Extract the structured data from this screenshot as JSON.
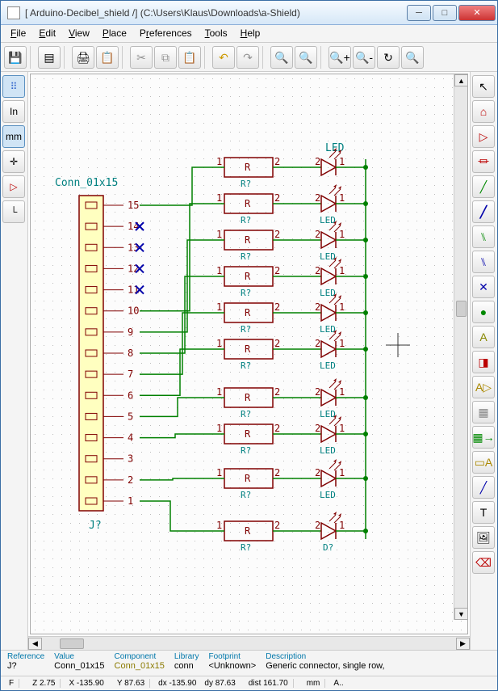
{
  "window": {
    "title": "[ Arduino-Decibel_shield /] (C:\\Users\\Klaus\\Downloads\\a-Shield)"
  },
  "menu": {
    "file": "File",
    "edit": "Edit",
    "view": "View",
    "place": "Place",
    "preferences": "Preferences",
    "tools": "Tools",
    "help": "Help"
  },
  "lefttools": {
    "grid": "⠿",
    "in": "In",
    "mm": "mm",
    "cursor": "✛",
    "hier": "▷",
    "axis": "└"
  },
  "schematic": {
    "conn_label": "Conn_01x15",
    "conn_ref": "J?",
    "pins": [
      "15",
      "14",
      "13",
      "12",
      "11",
      "10",
      "9",
      "8",
      "7",
      "6",
      "5",
      "4",
      "3",
      "2",
      "1"
    ],
    "led_label": "LED",
    "r_sym": "R",
    "r_ref": "R?",
    "d_ref": "D?",
    "led_ref": "LED",
    "pin1": "1",
    "pin2": "2"
  },
  "info": {
    "ref_lbl": "Reference",
    "ref_val": "J?",
    "val_lbl": "Value",
    "val_val": "Conn_01x15",
    "comp_lbl": "Component",
    "comp_val": "Conn_01x15",
    "lib_lbl": "Library",
    "lib_val": "conn",
    "fp_lbl": "Footprint",
    "fp_val": "<Unknown>",
    "desc_lbl": "Description",
    "desc_val": "Generic connector, single row,"
  },
  "status": {
    "f": "F",
    "z": "Z 2.75",
    "x": "X -135.90",
    "y": "Y 87.63",
    "dx": "dx -135.90",
    "dy": "dy 87.63",
    "dist": "dist 161.70",
    "unit": "mm",
    "a": "A.."
  }
}
